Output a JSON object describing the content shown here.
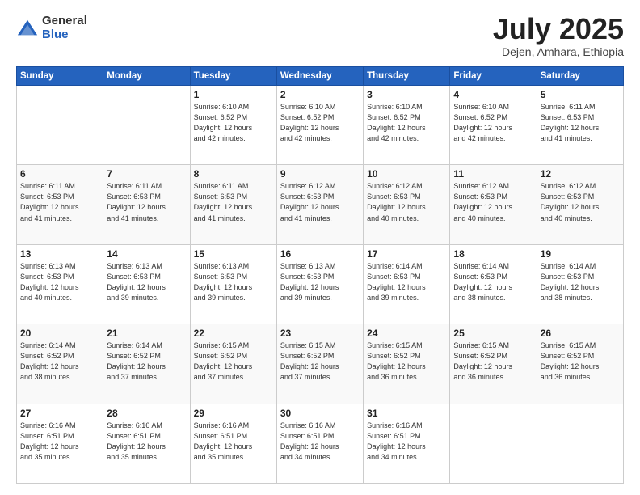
{
  "logo": {
    "general": "General",
    "blue": "Blue"
  },
  "title": {
    "month": "July 2025",
    "location": "Dejen, Amhara, Ethiopia"
  },
  "weekdays": [
    "Sunday",
    "Monday",
    "Tuesday",
    "Wednesday",
    "Thursday",
    "Friday",
    "Saturday"
  ],
  "weeks": [
    [
      {
        "day": "",
        "info": ""
      },
      {
        "day": "",
        "info": ""
      },
      {
        "day": "1",
        "info": "Sunrise: 6:10 AM\nSunset: 6:52 PM\nDaylight: 12 hours\nand 42 minutes."
      },
      {
        "day": "2",
        "info": "Sunrise: 6:10 AM\nSunset: 6:52 PM\nDaylight: 12 hours\nand 42 minutes."
      },
      {
        "day": "3",
        "info": "Sunrise: 6:10 AM\nSunset: 6:52 PM\nDaylight: 12 hours\nand 42 minutes."
      },
      {
        "day": "4",
        "info": "Sunrise: 6:10 AM\nSunset: 6:52 PM\nDaylight: 12 hours\nand 42 minutes."
      },
      {
        "day": "5",
        "info": "Sunrise: 6:11 AM\nSunset: 6:53 PM\nDaylight: 12 hours\nand 41 minutes."
      }
    ],
    [
      {
        "day": "6",
        "info": "Sunrise: 6:11 AM\nSunset: 6:53 PM\nDaylight: 12 hours\nand 41 minutes."
      },
      {
        "day": "7",
        "info": "Sunrise: 6:11 AM\nSunset: 6:53 PM\nDaylight: 12 hours\nand 41 minutes."
      },
      {
        "day": "8",
        "info": "Sunrise: 6:11 AM\nSunset: 6:53 PM\nDaylight: 12 hours\nand 41 minutes."
      },
      {
        "day": "9",
        "info": "Sunrise: 6:12 AM\nSunset: 6:53 PM\nDaylight: 12 hours\nand 41 minutes."
      },
      {
        "day": "10",
        "info": "Sunrise: 6:12 AM\nSunset: 6:53 PM\nDaylight: 12 hours\nand 40 minutes."
      },
      {
        "day": "11",
        "info": "Sunrise: 6:12 AM\nSunset: 6:53 PM\nDaylight: 12 hours\nand 40 minutes."
      },
      {
        "day": "12",
        "info": "Sunrise: 6:12 AM\nSunset: 6:53 PM\nDaylight: 12 hours\nand 40 minutes."
      }
    ],
    [
      {
        "day": "13",
        "info": "Sunrise: 6:13 AM\nSunset: 6:53 PM\nDaylight: 12 hours\nand 40 minutes."
      },
      {
        "day": "14",
        "info": "Sunrise: 6:13 AM\nSunset: 6:53 PM\nDaylight: 12 hours\nand 39 minutes."
      },
      {
        "day": "15",
        "info": "Sunrise: 6:13 AM\nSunset: 6:53 PM\nDaylight: 12 hours\nand 39 minutes."
      },
      {
        "day": "16",
        "info": "Sunrise: 6:13 AM\nSunset: 6:53 PM\nDaylight: 12 hours\nand 39 minutes."
      },
      {
        "day": "17",
        "info": "Sunrise: 6:14 AM\nSunset: 6:53 PM\nDaylight: 12 hours\nand 39 minutes."
      },
      {
        "day": "18",
        "info": "Sunrise: 6:14 AM\nSunset: 6:53 PM\nDaylight: 12 hours\nand 38 minutes."
      },
      {
        "day": "19",
        "info": "Sunrise: 6:14 AM\nSunset: 6:53 PM\nDaylight: 12 hours\nand 38 minutes."
      }
    ],
    [
      {
        "day": "20",
        "info": "Sunrise: 6:14 AM\nSunset: 6:52 PM\nDaylight: 12 hours\nand 38 minutes."
      },
      {
        "day": "21",
        "info": "Sunrise: 6:14 AM\nSunset: 6:52 PM\nDaylight: 12 hours\nand 37 minutes."
      },
      {
        "day": "22",
        "info": "Sunrise: 6:15 AM\nSunset: 6:52 PM\nDaylight: 12 hours\nand 37 minutes."
      },
      {
        "day": "23",
        "info": "Sunrise: 6:15 AM\nSunset: 6:52 PM\nDaylight: 12 hours\nand 37 minutes."
      },
      {
        "day": "24",
        "info": "Sunrise: 6:15 AM\nSunset: 6:52 PM\nDaylight: 12 hours\nand 36 minutes."
      },
      {
        "day": "25",
        "info": "Sunrise: 6:15 AM\nSunset: 6:52 PM\nDaylight: 12 hours\nand 36 minutes."
      },
      {
        "day": "26",
        "info": "Sunrise: 6:15 AM\nSunset: 6:52 PM\nDaylight: 12 hours\nand 36 minutes."
      }
    ],
    [
      {
        "day": "27",
        "info": "Sunrise: 6:16 AM\nSunset: 6:51 PM\nDaylight: 12 hours\nand 35 minutes."
      },
      {
        "day": "28",
        "info": "Sunrise: 6:16 AM\nSunset: 6:51 PM\nDaylight: 12 hours\nand 35 minutes."
      },
      {
        "day": "29",
        "info": "Sunrise: 6:16 AM\nSunset: 6:51 PM\nDaylight: 12 hours\nand 35 minutes."
      },
      {
        "day": "30",
        "info": "Sunrise: 6:16 AM\nSunset: 6:51 PM\nDaylight: 12 hours\nand 34 minutes."
      },
      {
        "day": "31",
        "info": "Sunrise: 6:16 AM\nSunset: 6:51 PM\nDaylight: 12 hours\nand 34 minutes."
      },
      {
        "day": "",
        "info": ""
      },
      {
        "day": "",
        "info": ""
      }
    ]
  ]
}
